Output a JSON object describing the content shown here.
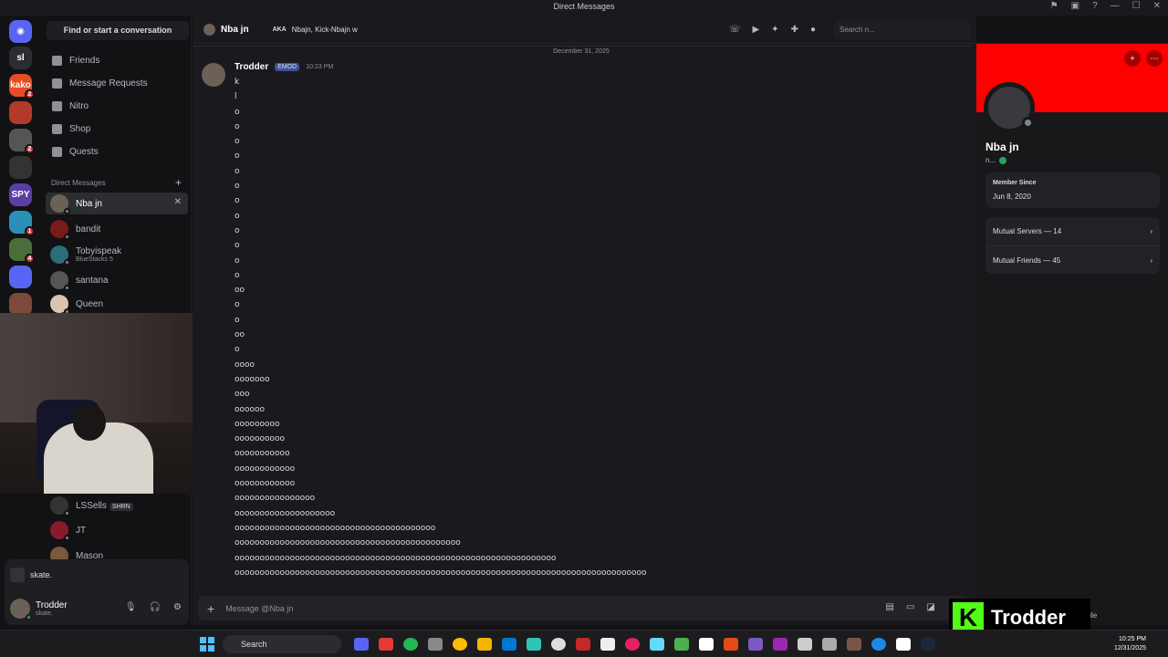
{
  "window": {
    "title": "Direct Messages"
  },
  "servers": [
    {
      "label": "sl",
      "color": "#2b2d31",
      "badge": ""
    },
    {
      "label": "kako",
      "color": "#e44d26",
      "badge": "2"
    },
    {
      "label": "",
      "color": "#b33a2a",
      "badge": ""
    },
    {
      "label": "",
      "color": "#555",
      "badge": "2"
    },
    {
      "label": "",
      "color": "#333",
      "badge": ""
    },
    {
      "label": "SPY",
      "color": "#5a3ea6",
      "badge": ""
    },
    {
      "label": "",
      "color": "#2c8fb8",
      "badge": "1"
    },
    {
      "label": "",
      "color": "#4a6e3a",
      "badge": "4"
    },
    {
      "label": "",
      "color": "#5865f2",
      "badge": ""
    },
    {
      "label": "",
      "color": "#7a4a3a",
      "badge": ""
    }
  ],
  "sidebar": {
    "find": "Find or start a conversation",
    "nav": [
      "Friends",
      "Message Requests",
      "Nitro",
      "Shop",
      "Quests"
    ],
    "dm_header": "Direct Messages",
    "dms": [
      {
        "name": "Nba jn",
        "sub": "",
        "tag": "",
        "color": "#6b6157"
      },
      {
        "name": "bandit",
        "sub": "",
        "tag": "",
        "color": "#7a1a1a"
      },
      {
        "name": "Tobyispeak",
        "sub": "BlueStacks 5",
        "tag": "",
        "color": "#2a6e7a"
      },
      {
        "name": "santana",
        "sub": "",
        "tag": "",
        "color": "#555"
      },
      {
        "name": "Queen",
        "sub": "",
        "tag": "",
        "color": "#d9c4b0"
      },
      {
        "name": "LSSells",
        "sub": "",
        "tag": "SHRN",
        "color": "#333"
      },
      {
        "name": "JT",
        "sub": "",
        "tag": "",
        "color": "#8a1a2a"
      },
      {
        "name": "Mason",
        "sub": "",
        "tag": "",
        "color": "#7a5a3a"
      }
    ]
  },
  "user_panel": {
    "activity": "skate.",
    "name": "Trodder",
    "status": "skate."
  },
  "chat": {
    "name": "Nba jn",
    "aka": "AKA",
    "aka_names": "Nbajn, Kick-Nbajn w",
    "search_placeholder": "Search n...",
    "date": "December 31, 2025",
    "author": "Trodder",
    "badge": "EMOD",
    "time": "10:23 PM",
    "lines": [
      "k",
      "l",
      "o",
      "o",
      "o",
      "o",
      "o",
      "o",
      "o",
      "o",
      "o",
      "o",
      "o",
      "o",
      "oo",
      "o",
      "o",
      "oo",
      "o",
      "oooo",
      "ooooooo",
      "ooo",
      "oooooo",
      "ooooooooo",
      "oooooooooo",
      "ooooooooooo",
      "oooooooooooo",
      "oooooooooooo",
      "oooooooooooooooo",
      "oooooooooooooooooooo",
      "oooooooooooooooooooooooooooooooooooooooo",
      "ooooooooooooooooooooooooooooooooooooooooooooo",
      "oooooooooooooooooooooooooooooooooooooooooooooooooooooooooooooooo",
      "oooooooooooooooooooooooooooooooooooooooooooooooooooooooooooooooooooooooooooooooooo"
    ],
    "placeholder": "Message @Nba jn"
  },
  "profile": {
    "name": "Nba jn",
    "username": "n...",
    "member_since_label": "Member Since",
    "member_since": "Jun 8, 2020",
    "mutual_servers": "Mutual Servers — 14",
    "mutual_friends": "Mutual Friends — 45",
    "banner_color": "#ff0000",
    "footer_text": "file"
  },
  "overlay": {
    "text": "Trodder",
    "accent": "#53fc18"
  },
  "taskbar": {
    "search": "Search",
    "time": "10:25 PM",
    "date": "12/31/2025"
  }
}
